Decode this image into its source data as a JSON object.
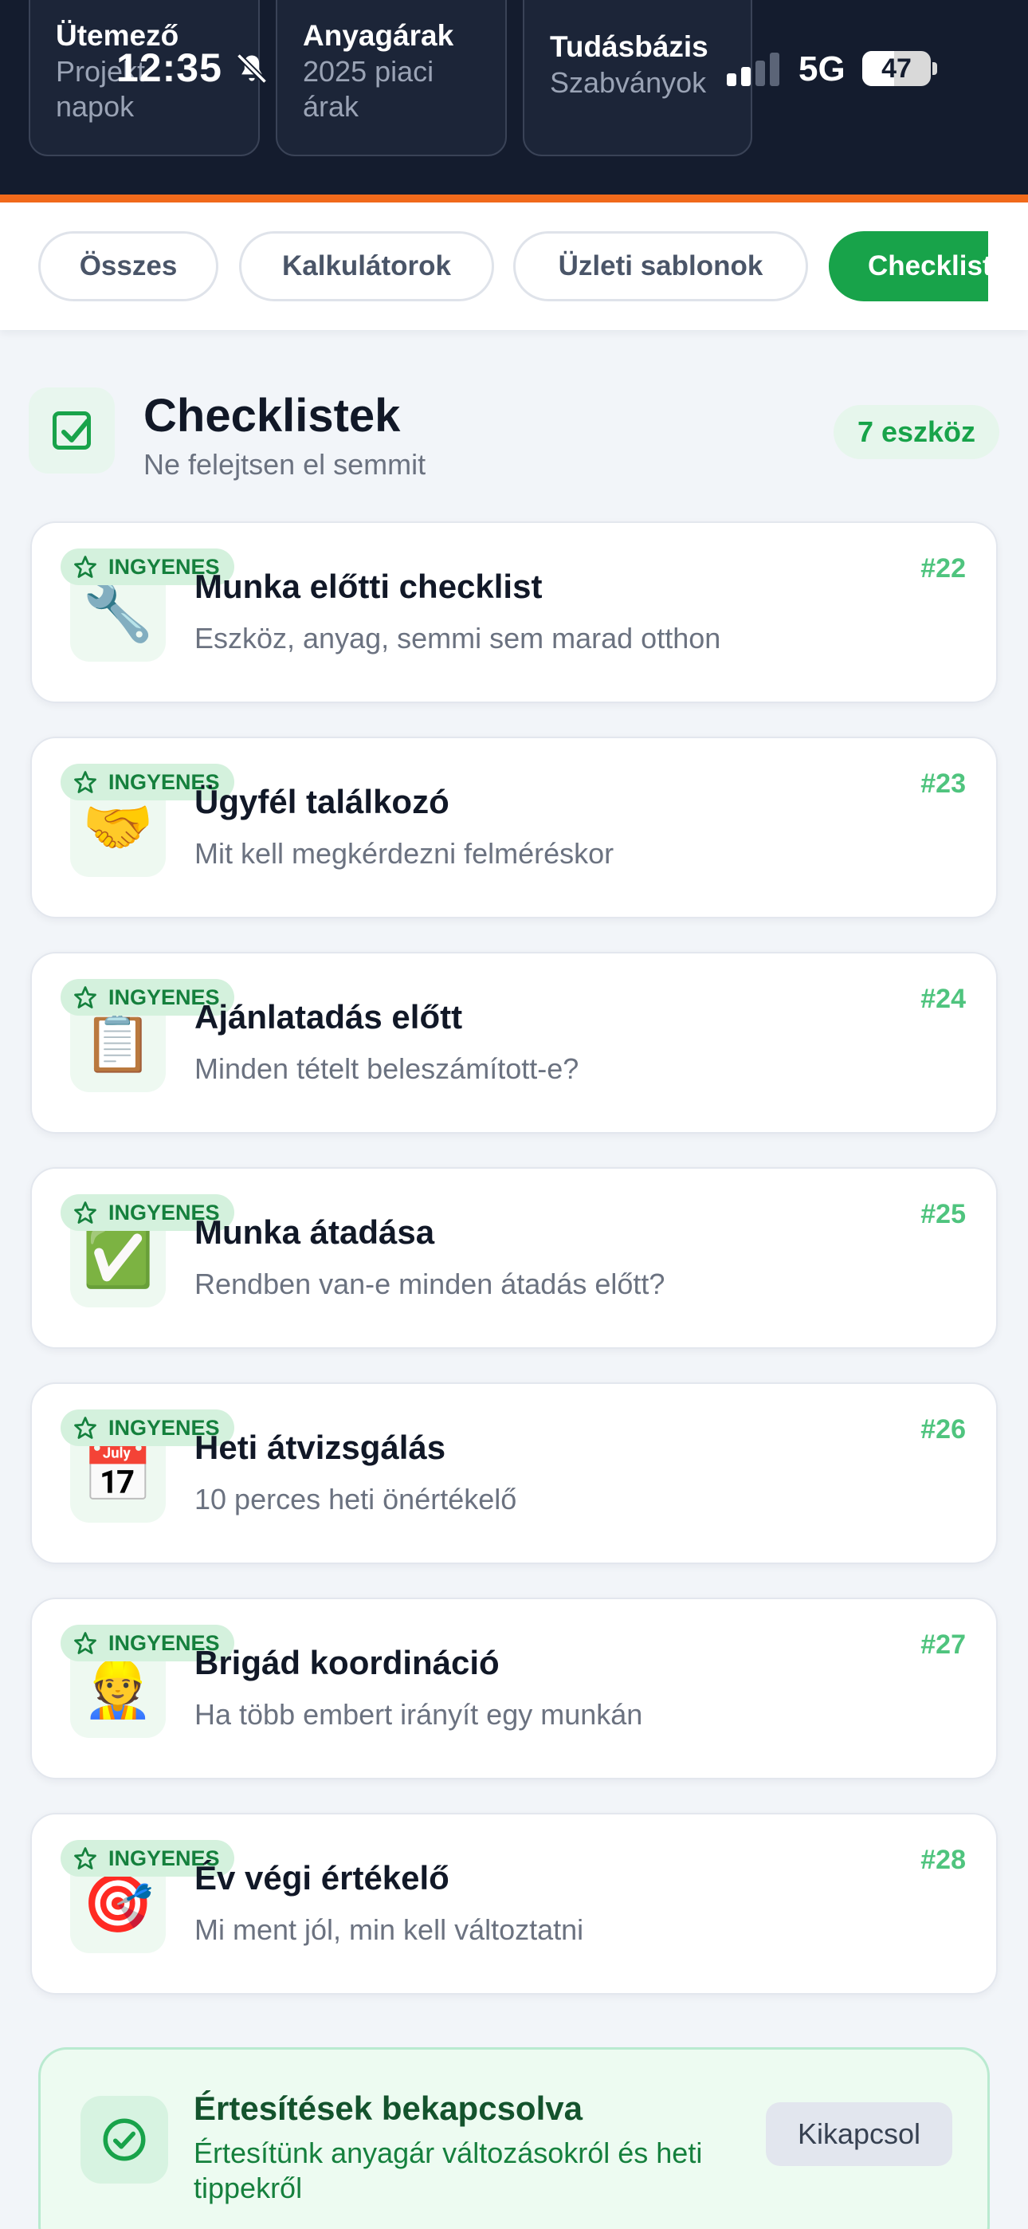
{
  "status_bar": {
    "time": "12:35",
    "network": "5G",
    "battery": "47"
  },
  "header_cards": [
    {
      "title": "Ütemező",
      "subtitle_lines": [
        "Projekt",
        "napok"
      ]
    },
    {
      "title": "Anyagárak",
      "subtitle_lines": [
        "2025 piaci",
        "árak"
      ]
    },
    {
      "title": "Tudásbázis",
      "subtitle_lines": [
        "Szabványok"
      ]
    }
  ],
  "filters": [
    {
      "label": "Összes",
      "active": false
    },
    {
      "label": "Kalkulátorok",
      "active": false
    },
    {
      "label": "Üzleti sablonok",
      "active": false
    },
    {
      "label": "Checklist",
      "active": true
    }
  ],
  "section": {
    "title": "Checklistek",
    "subtitle": "Ne felejtsen el semmit",
    "count": "7 eszköz"
  },
  "cards": [
    {
      "badge": "INGYENES",
      "emoji": "🔧",
      "title": "Munka előtti checklist",
      "desc": "Eszköz, anyag, semmi sem marad otthon",
      "num": "#22"
    },
    {
      "badge": "INGYENES",
      "emoji": "🤝",
      "title": "Ügyfél találkozó",
      "desc": "Mit kell megkérdezni felméréskor",
      "num": "#23"
    },
    {
      "badge": "INGYENES",
      "emoji": "📋",
      "title": "Ajánlatadás előtt",
      "desc": "Minden tételt beleszámított-e?",
      "num": "#24"
    },
    {
      "badge": "INGYENES",
      "emoji": "✅",
      "title": "Munka átadása",
      "desc": "Rendben van-e minden átadás előtt?",
      "num": "#25"
    },
    {
      "badge": "INGYENES",
      "emoji": "📅",
      "title": "Heti átvizsgálás",
      "desc": "10 perces heti önértékelő",
      "num": "#26"
    },
    {
      "badge": "INGYENES",
      "emoji": "👷",
      "title": "Brigád koordináció",
      "desc": "Ha több embert irányít egy munkán",
      "num": "#27"
    },
    {
      "badge": "INGYENES",
      "emoji": "🎯",
      "title": "Év végi értékelő",
      "desc": "Mi ment jól, min kell változtatni",
      "num": "#28"
    }
  ],
  "notification": {
    "title": "Értesítések bekapcsolva",
    "text": "Értesítünk anyagár változásokról és heti tippekről",
    "button": "Kikapcsol"
  },
  "colors": {
    "header_bg": "#141c2e",
    "accent_orange": "#f26a1b",
    "brand_green": "#18a34a",
    "number_green": "#4fc47e"
  }
}
